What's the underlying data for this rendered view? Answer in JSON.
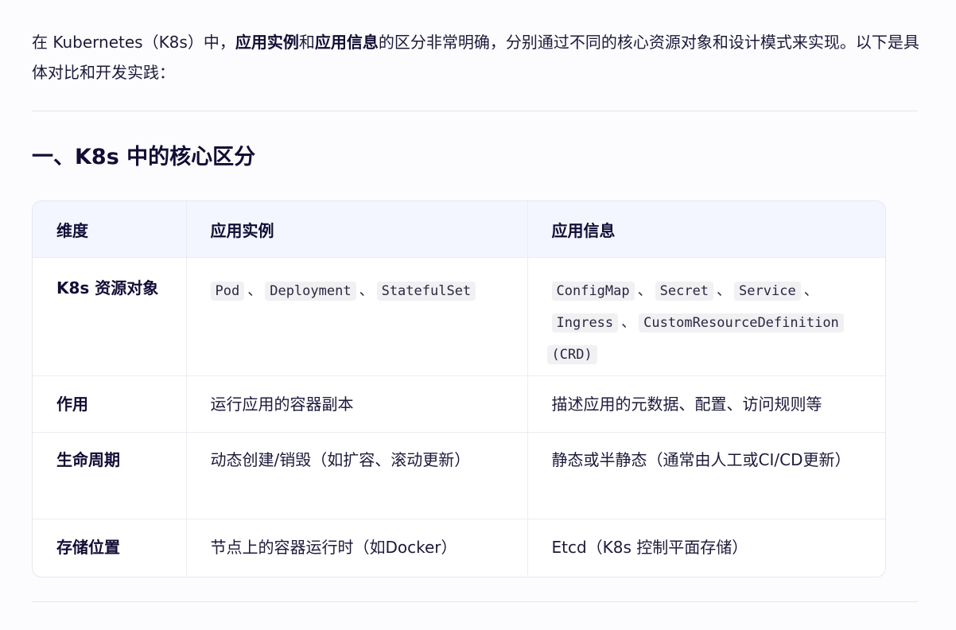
{
  "intro": {
    "part1": "在 Kubernetes（K8s）中，",
    "bold1": "应用实例",
    "part2": "和",
    "bold2": "应用信息",
    "part3": "的区分非常明确，分别通过不同的核心资源对象和设计模式来实现。以下是具体对比和开发实践："
  },
  "section_heading": "一、K8s 中的核心区分",
  "table": {
    "headers": [
      "维度",
      "应用实例",
      "应用信息"
    ],
    "rows": [
      {
        "dimension": "K8s 资源对象",
        "instance_codes": [
          "Pod",
          "Deployment",
          "StatefulSet"
        ],
        "info_codes": [
          "ConfigMap",
          "Secret",
          "Service",
          "Ingress",
          "CustomResourceDefinition",
          "(CRD)"
        ]
      },
      {
        "dimension": "作用",
        "instance": "运行应用的容器副本",
        "info": "描述应用的元数据、配置、访问规则等"
      },
      {
        "dimension": "生命周期",
        "instance": "动态创建/销毁（如扩容、滚动更新）",
        "info": "静态或半静态（通常由人工或CI/CD更新）"
      },
      {
        "dimension": "存储位置",
        "instance": "节点上的容器运行时（如Docker）",
        "info": "Etcd（K8s 控制平面存储）"
      }
    ],
    "separator": "、"
  }
}
